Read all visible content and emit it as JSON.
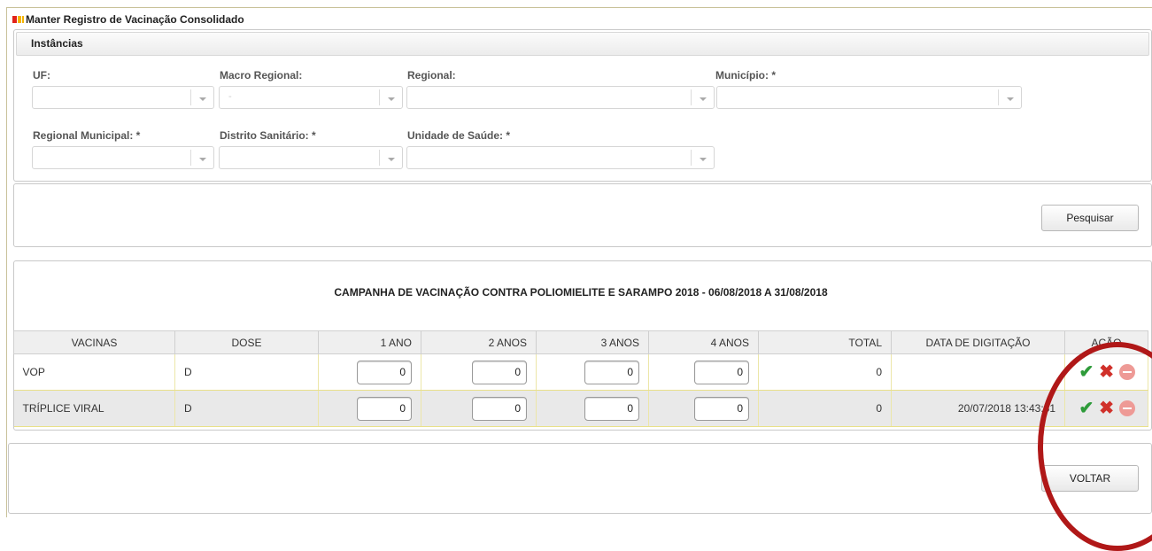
{
  "page": {
    "title": "Manter Registro de Vacinação Consolidado"
  },
  "instancias": {
    "header": "Instâncias",
    "fields": [
      {
        "label": "UF:",
        "value": ""
      },
      {
        "label": "Macro Regional:",
        "value": "-"
      },
      {
        "label": "Regional:",
        "value": ""
      },
      {
        "label": "Município:  *",
        "value": ""
      },
      {
        "label": "Regional Municipal:  *",
        "value": ""
      },
      {
        "label": "Distrito Sanitário:  *",
        "value": ""
      },
      {
        "label": "Unidade de Saúde:  *",
        "value": ""
      }
    ]
  },
  "search": {
    "button_label": "Pesquisar"
  },
  "campaign": {
    "title": "CAMPANHA DE VACINAÇÃO CONTRA POLIOMIELITE E SARAMPO 2018 - 06/08/2018 A 31/08/2018"
  },
  "table": {
    "headers": [
      "VACINAS",
      "DOSE",
      "1 ANO",
      "2 ANOS",
      "3 ANOS",
      "4 ANOS",
      "TOTAL",
      "DATA DE DIGITAÇÃO",
      "AÇÃO"
    ],
    "rows": [
      {
        "vacina": "VOP",
        "dose": "D",
        "ano1": "0",
        "ano2": "0",
        "ano3": "0",
        "ano4": "0",
        "total": "0",
        "data": ""
      },
      {
        "vacina": "TRÍPLICE VIRAL",
        "dose": "D",
        "ano1": "0",
        "ano2": "0",
        "ano3": "0",
        "ano4": "0",
        "total": "0",
        "data": "20/07/2018 13:43:51"
      }
    ]
  },
  "footer": {
    "back_label": "VOLTAR"
  },
  "icons": {
    "confirm": "check-icon",
    "cancel": "close-icon",
    "remove": "remove-circle-icon"
  },
  "colors": {
    "confirm": "#2e9b3a",
    "cancel": "#d0302a",
    "remove": "#ee9a96",
    "highlight_circle": "#b01818"
  }
}
